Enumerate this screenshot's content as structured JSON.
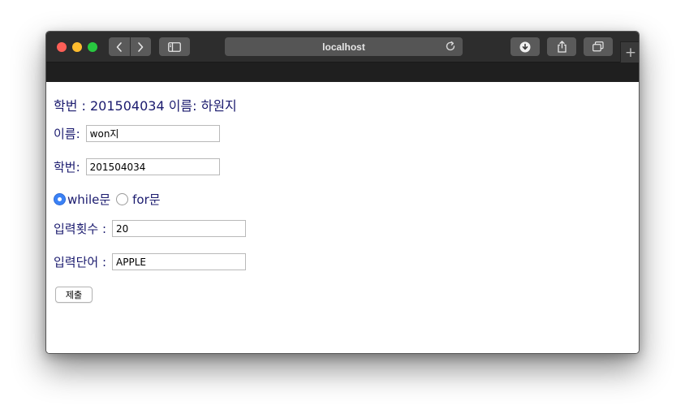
{
  "browser": {
    "url": "localhost"
  },
  "page": {
    "heading": "학번 : 201504034 이름: 하원지",
    "name_label": "이름:",
    "name_value": "won지",
    "id_label": "학번:",
    "id_value": "201504034",
    "radio_while_label": "while문",
    "radio_for_label": "for문",
    "radio_selected": "while문",
    "count_label": "입력횟수 :",
    "count_value": "20",
    "word_label": "입력단어 :",
    "word_value": "APPLE",
    "submit_label": "제출"
  },
  "icons": {
    "back": "chevron-left-icon",
    "forward": "chevron-right-icon",
    "sidebar": "sidebar-icon",
    "reload": "reload-icon",
    "download": "download-icon",
    "share": "share-icon",
    "tabs": "tabs-overview-icon",
    "new_tab": "plus-icon"
  },
  "colors": {
    "titlebar": "#2d2d2d",
    "text": "#1a1a6e",
    "radio_accent": "#3b82f6",
    "close": "#fe5f57",
    "minimize": "#febc2e",
    "maximize": "#28c840"
  }
}
